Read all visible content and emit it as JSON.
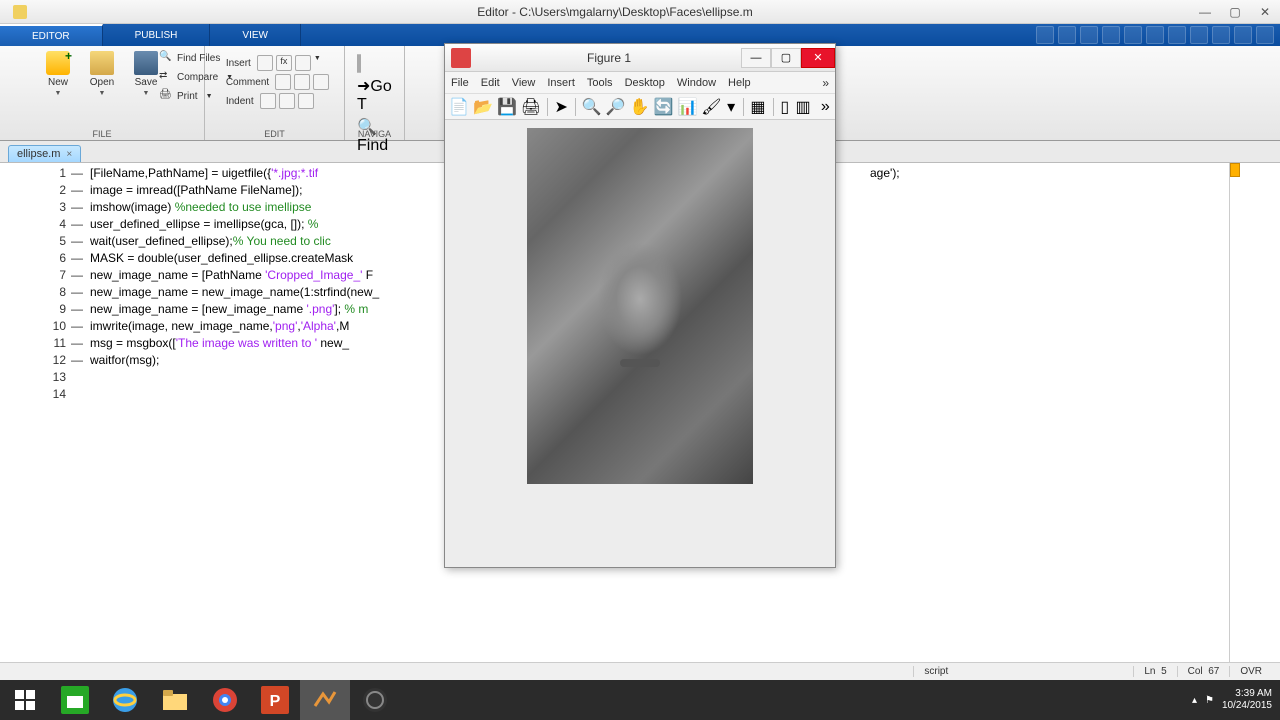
{
  "window": {
    "title": "Editor - C:\\Users\\mgalarny\\Desktop\\Faces\\ellipse.m",
    "min": "—",
    "max": "▢",
    "close": "✕"
  },
  "tabs": {
    "editor": "EDITOR",
    "publish": "PUBLISH",
    "view": "VIEW"
  },
  "ribbon": {
    "file": {
      "title": "FILE",
      "new": "New",
      "open": "Open",
      "save": "Save",
      "findfiles": "Find Files",
      "compare": "Compare",
      "print": "Print"
    },
    "edit": {
      "title": "EDIT",
      "insert": "Insert",
      "comment": "Comment",
      "indent": "Indent"
    },
    "nav": {
      "title": "NAVIGA",
      "goto": "Go T",
      "find": "Find"
    }
  },
  "filetab": {
    "name": "ellipse.m",
    "close": "×"
  },
  "code": {
    "lines": [
      1,
      2,
      3,
      4,
      5,
      6,
      7,
      8,
      9,
      10,
      11,
      12,
      13,
      14
    ],
    "dashes": [
      "—",
      "—",
      "—",
      "—",
      "—",
      "—",
      "—",
      "—",
      "—",
      "—",
      "—",
      "—",
      "",
      ""
    ],
    "l1a": "[FileName,PathName] = uigetfile({",
    "l1b": "'*.jpg;*.tif",
    "l2": "image = imread([PathName FileName]);",
    "l3a": "imshow(image) ",
    "l3b": "%needed to use imellipse",
    "l4a": "user_defined_ellipse = imellipse(gca, []); ",
    "l4b": "% ",
    "l5a": "wait(user_defined_ellipse);",
    "l5b": "% You need to clic",
    "l6": "MASK = double(user_defined_ellipse.createMask",
    "l7a": "new_image_name = [PathName ",
    "l7b": "'Cropped_Image_'",
    "l7c": " F",
    "l8": "new_image_name = new_image_name(1:strfind(new_",
    "l9a": "new_image_name = [new_image_name ",
    "l9b": "'.png'",
    "l9c": "]; ",
    "l9d": "% m",
    "l10a": "imwrite(image, new_image_name,",
    "l10b": "'png'",
    "l10c": ",",
    "l10d": "'Alpha'",
    "l10e": ",M",
    "l11a": "msg = msgbox([",
    "l11b": "'The image was written to '",
    "l11c": " new_",
    "l12": "waitfor(msg);",
    "rside1a": "age'",
    "rside1b": ");"
  },
  "figure": {
    "title": "Figure 1",
    "menu": [
      "File",
      "Edit",
      "View",
      "Insert",
      "Tools",
      "Desktop",
      "Window",
      "Help"
    ],
    "expand": "»",
    "min": "—",
    "max": "▢"
  },
  "status": {
    "script": "script",
    "ln": "Ln",
    "lnv": "5",
    "col": "Col",
    "colv": "67",
    "ovr": "OVR"
  },
  "tray": {
    "time": "3:39 AM",
    "date": "10/24/2015"
  }
}
